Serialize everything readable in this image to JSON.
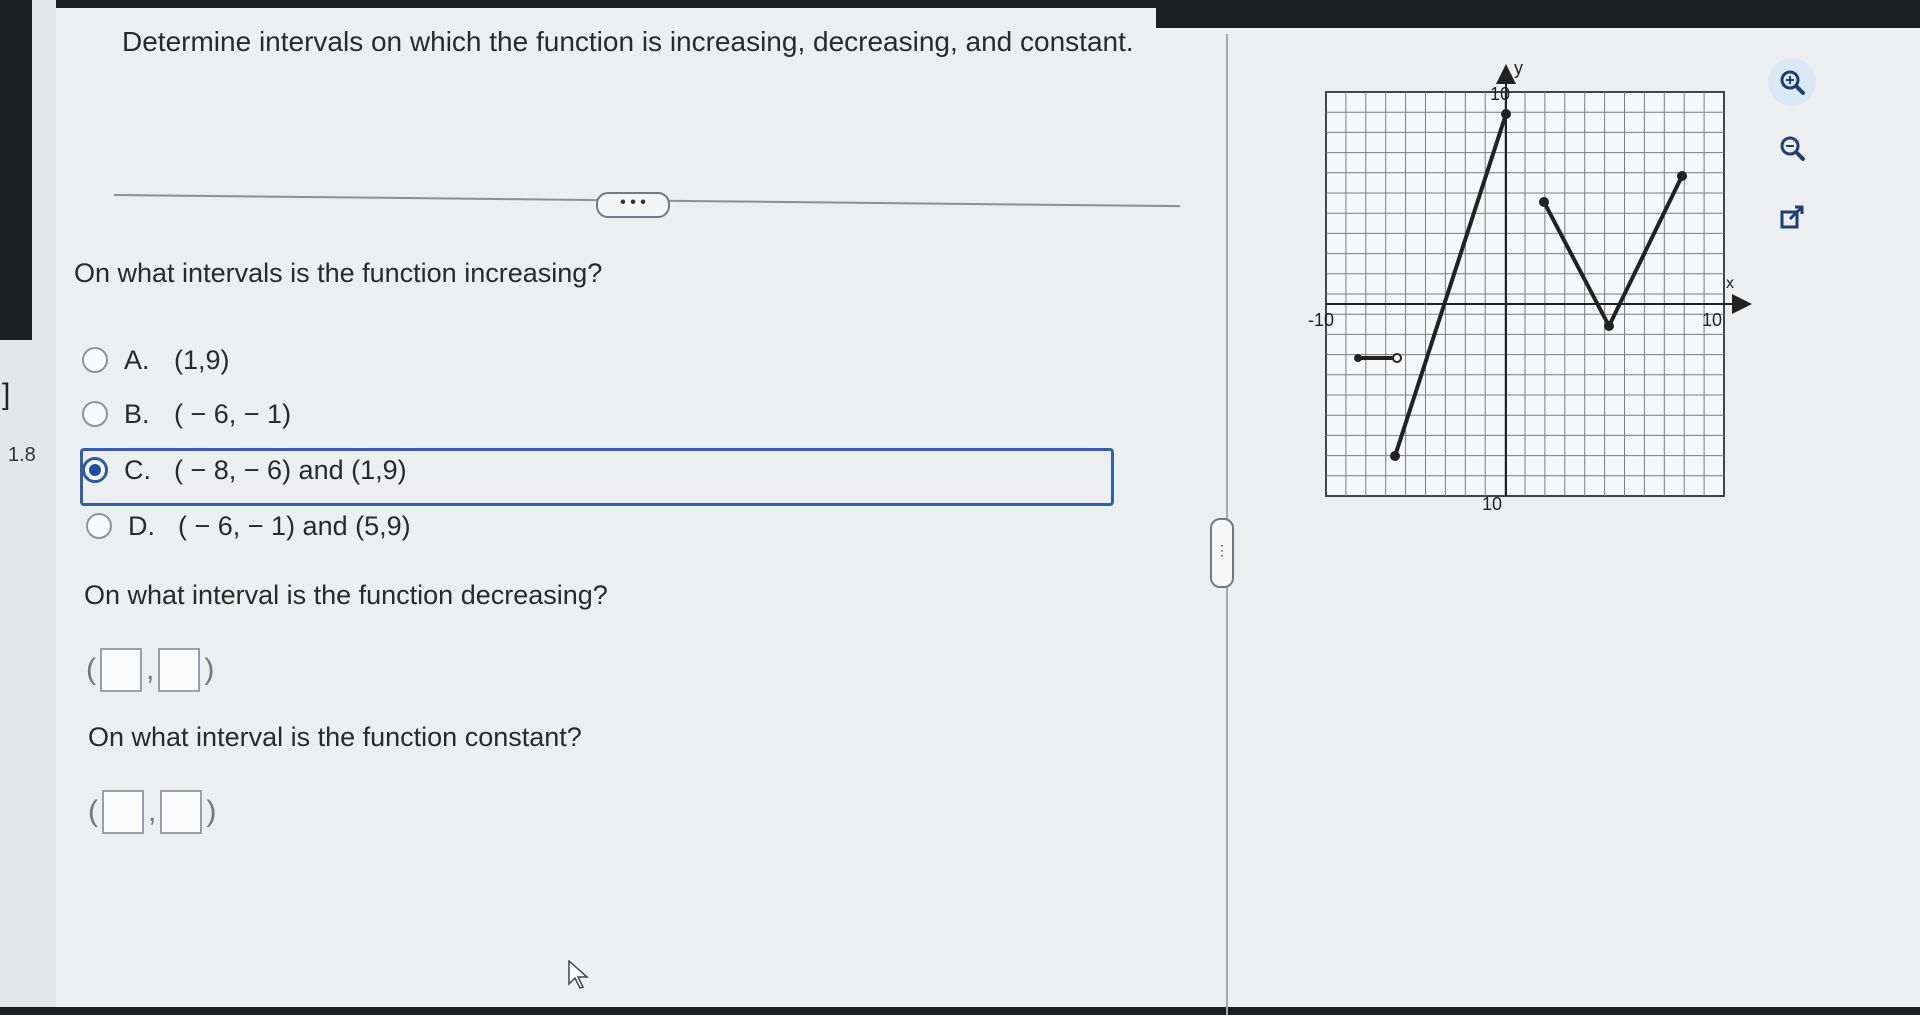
{
  "question": {
    "title": "Determine intervals on which the function is increasing, decreasing, and constant.",
    "more_label": "• • •",
    "increasing_prompt": "On what intervals is the function increasing?",
    "options": [
      {
        "letter": "A.",
        "text": "(1,9)",
        "selected": false
      },
      {
        "letter": "B.",
        "text": "( − 6, − 1)",
        "selected": false
      },
      {
        "letter": "C.",
        "text": "( − 8, − 6) and (1,9)",
        "selected": true
      },
      {
        "letter": "D.",
        "text": "( − 6, − 1) and (5,9)",
        "selected": false
      }
    ],
    "decreasing_prompt": "On what interval is the function decreasing?",
    "constant_prompt": "On what interval is the function constant?",
    "paren_open": "(",
    "comma": ",",
    "paren_close": ")"
  },
  "left_strip": {
    "bracket": "]",
    "number": "1.8"
  },
  "graph": {
    "y_label": "y",
    "x_label": "x",
    "tick_top": "10",
    "tick_bottom": "10",
    "tick_left": "-10",
    "tick_right": "10"
  },
  "tools": [
    {
      "name": "zoom-in-icon"
    },
    {
      "name": "zoom-out-icon"
    },
    {
      "name": "pop-out-icon"
    }
  ]
}
